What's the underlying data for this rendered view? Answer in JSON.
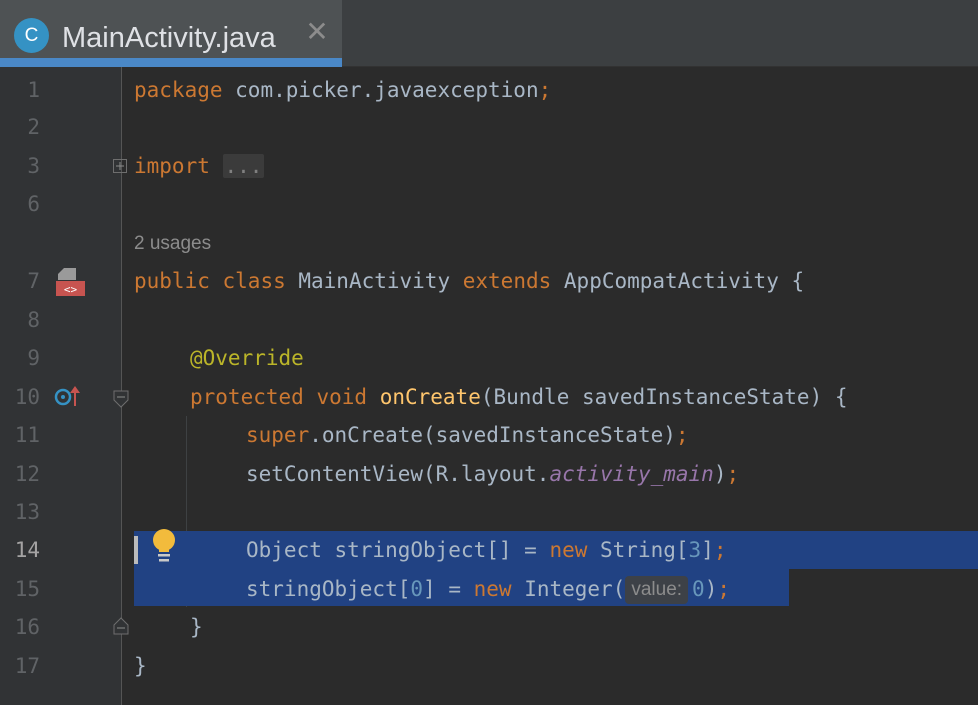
{
  "tab": {
    "icon_letter": "C",
    "title": "MainActivity.java",
    "close_glyph": "✕"
  },
  "line_numbers": [
    "1",
    "2",
    "3",
    "6",
    "7",
    "8",
    "9",
    "10",
    "11",
    "12",
    "13",
    "14",
    "15",
    "16",
    "17"
  ],
  "code": {
    "l1": {
      "kw": "package",
      "rest": " com.picker.javaexception",
      "semi": ";"
    },
    "l3": {
      "kw": "import",
      "fold": "..."
    },
    "usages": "2 usages",
    "l7": {
      "kw1": "public",
      "kw2": "class",
      "name": " MainActivity ",
      "kw3": "extends",
      "rest": " AppCompatActivity {"
    },
    "l9": {
      "ann": "@Override"
    },
    "l10": {
      "kw1": "protected",
      "kw2": "void",
      "fn": "onCreate",
      "rest": "(Bundle savedInstanceState) {"
    },
    "l11": {
      "kw": "super",
      "rest": ".onCreate(savedInstanceState)",
      "semi": ";"
    },
    "l12": {
      "pre": "setContentView(R.layout.",
      "field": "activity_main",
      "post": ")",
      "semi": ";"
    },
    "l14": {
      "pre": "Object stringObject[] = ",
      "kw": "new",
      "mid": " String[",
      "num": "3",
      "post": "]",
      "semi": ";"
    },
    "l15": {
      "pre": "stringObject[",
      "num": "0",
      "mid": "] = ",
      "kw": "new",
      "mid2": " Integer(",
      "hint": "value:",
      "num2": "0",
      "post": ")",
      "semi": ";"
    },
    "l16": "}",
    "l17": "}"
  },
  "colors": {
    "background": "#2b2b2b",
    "keyword": "#cc7832",
    "selection": "#214283",
    "tab_accent": "#4a88c7"
  },
  "icons": {
    "class_icon": "class-c-icon",
    "implements_icon": "layout-xml-icon",
    "override_icon": "override-method-icon",
    "intention_icon": "lightbulb-icon"
  }
}
